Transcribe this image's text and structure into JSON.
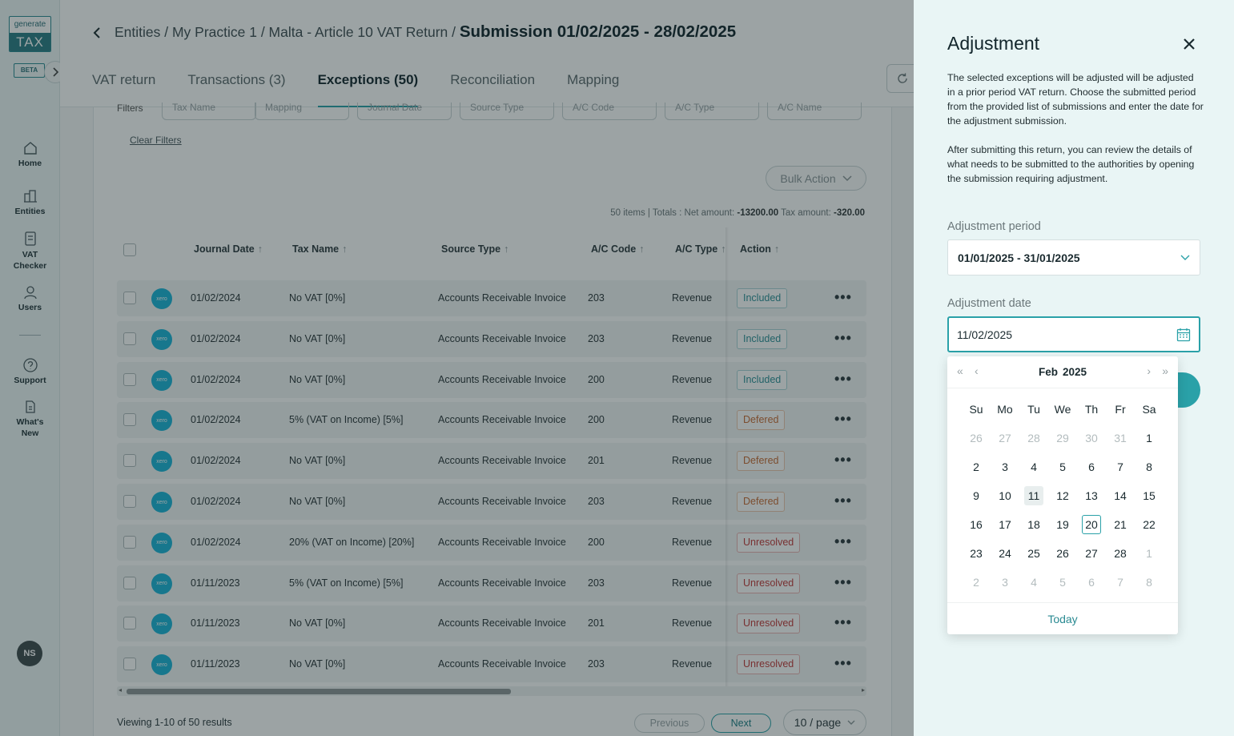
{
  "sidebar": {
    "logo_top": "generate",
    "logo_bottom": "TAX",
    "beta": "BETA",
    "items": [
      {
        "label": "Home"
      },
      {
        "label": "Entities"
      },
      {
        "label": "VAT Checker"
      },
      {
        "label": "Users"
      },
      {
        "label": "Support"
      },
      {
        "label": "What's New"
      }
    ],
    "avatar": "NS"
  },
  "header": {
    "breadcrumb": "Entities / My Practice 1 / Malta - Article 10 VAT Return / ",
    "title": "Submission 01/02/2025 - 28/02/2025",
    "tabs": [
      "VAT return",
      "Transactions (3)",
      "Exceptions (50)",
      "Reconciliation",
      "Mapping"
    ],
    "active_tab": "Exceptions (50)"
  },
  "filters": {
    "label": "Filters",
    "items": [
      "Tax Name",
      "Mapping",
      "Journal Date",
      "Source Type",
      "A/C Code",
      "A/C Type",
      "A/C Name"
    ],
    "clear": "Clear Filters"
  },
  "bulk_action": "Bulk Action",
  "totals": {
    "items": "50 items | Totals : Net amount: ",
    "net": "-13200.00",
    "tax_label": " Tax amount: ",
    "tax": "-320.00"
  },
  "table": {
    "columns": [
      "Journal Date",
      "Tax Name",
      "Source Type",
      "A/C Code",
      "A/C Type",
      "Action"
    ],
    "rows": [
      {
        "date": "01/02/2024",
        "tax": "No VAT [0%]",
        "source": "Accounts Receivable Invoice",
        "code": "203",
        "type": "Revenue",
        "status": "Included"
      },
      {
        "date": "01/02/2024",
        "tax": "No VAT [0%]",
        "source": "Accounts Receivable Invoice",
        "code": "203",
        "type": "Revenue",
        "status": "Included"
      },
      {
        "date": "01/02/2024",
        "tax": "No VAT [0%]",
        "source": "Accounts Receivable Invoice",
        "code": "200",
        "type": "Revenue",
        "status": "Included"
      },
      {
        "date": "01/02/2024",
        "tax": "5% (VAT on Income) [5%]",
        "source": "Accounts Receivable Invoice",
        "code": "200",
        "type": "Revenue",
        "status": "Defered"
      },
      {
        "date": "01/02/2024",
        "tax": "No VAT [0%]",
        "source": "Accounts Receivable Invoice",
        "code": "201",
        "type": "Revenue",
        "status": "Defered"
      },
      {
        "date": "01/02/2024",
        "tax": "No VAT [0%]",
        "source": "Accounts Receivable Invoice",
        "code": "203",
        "type": "Revenue",
        "status": "Defered"
      },
      {
        "date": "01/02/2024",
        "tax": "20% (VAT on Income) [20%]",
        "source": "Accounts Receivable Invoice",
        "code": "200",
        "type": "Revenue",
        "status": "Unresolved"
      },
      {
        "date": "01/11/2023",
        "tax": "5% (VAT on Income) [5%]",
        "source": "Accounts Receivable Invoice",
        "code": "203",
        "type": "Revenue",
        "status": "Unresolved"
      },
      {
        "date": "01/11/2023",
        "tax": "No VAT [0%]",
        "source": "Accounts Receivable Invoice",
        "code": "201",
        "type": "Revenue",
        "status": "Unresolved"
      },
      {
        "date": "01/11/2023",
        "tax": "No VAT [0%]",
        "source": "Accounts Receivable Invoice",
        "code": "203",
        "type": "Revenue",
        "status": "Unresolved"
      }
    ],
    "source_icon_text": "xero"
  },
  "pagination": {
    "viewing": "Viewing 1-10 of 50 results",
    "previous": "Previous",
    "next": "Next",
    "page_size": "10 / page"
  },
  "drawer": {
    "title": "Adjustment",
    "description_1": "The selected exceptions will be adjusted will be adjusted in a prior period VAT return. Choose the submitted period from the provided list of submissions and enter the date for the adjustment submission.",
    "description_2": "After submitting this return, you can review the details of what needs to be submitted to the authorities by opening the submission requiring adjustment.",
    "period_label": "Adjustment period",
    "period_value": "01/01/2025 - 31/01/2025",
    "date_label": "Adjustment date",
    "date_value": "11/02/2025"
  },
  "calendar": {
    "month": "Feb",
    "year": "2025",
    "weekdays": [
      "Su",
      "Mo",
      "Tu",
      "We",
      "Th",
      "Fr",
      "Sa"
    ],
    "weeks": [
      [
        {
          "d": "26",
          "m": true
        },
        {
          "d": "27",
          "m": true
        },
        {
          "d": "28",
          "m": true
        },
        {
          "d": "29",
          "m": true
        },
        {
          "d": "30",
          "m": true
        },
        {
          "d": "31",
          "m": true
        },
        {
          "d": "1"
        }
      ],
      [
        {
          "d": "2"
        },
        {
          "d": "3"
        },
        {
          "d": "4"
        },
        {
          "d": "5"
        },
        {
          "d": "6"
        },
        {
          "d": "7"
        },
        {
          "d": "8"
        }
      ],
      [
        {
          "d": "9"
        },
        {
          "d": "10"
        },
        {
          "d": "11",
          "sel": true
        },
        {
          "d": "12"
        },
        {
          "d": "13"
        },
        {
          "d": "14"
        },
        {
          "d": "15"
        }
      ],
      [
        {
          "d": "16"
        },
        {
          "d": "17"
        },
        {
          "d": "18"
        },
        {
          "d": "19"
        },
        {
          "d": "20",
          "today": true
        },
        {
          "d": "21"
        },
        {
          "d": "22"
        }
      ],
      [
        {
          "d": "23"
        },
        {
          "d": "24"
        },
        {
          "d": "25"
        },
        {
          "d": "26"
        },
        {
          "d": "27"
        },
        {
          "d": "28"
        },
        {
          "d": "1",
          "m": true
        }
      ],
      [
        {
          "d": "2",
          "m": true
        },
        {
          "d": "3",
          "m": true
        },
        {
          "d": "4",
          "m": true
        },
        {
          "d": "5",
          "m": true
        },
        {
          "d": "6",
          "m": true
        },
        {
          "d": "7",
          "m": true
        },
        {
          "d": "8",
          "m": true
        }
      ]
    ],
    "today_label": "Today"
  },
  "colors": {
    "accent": "#2aa1a8",
    "included": "#2d8f97",
    "defered": "#c86c35",
    "unresolved": "#c23a3a"
  }
}
